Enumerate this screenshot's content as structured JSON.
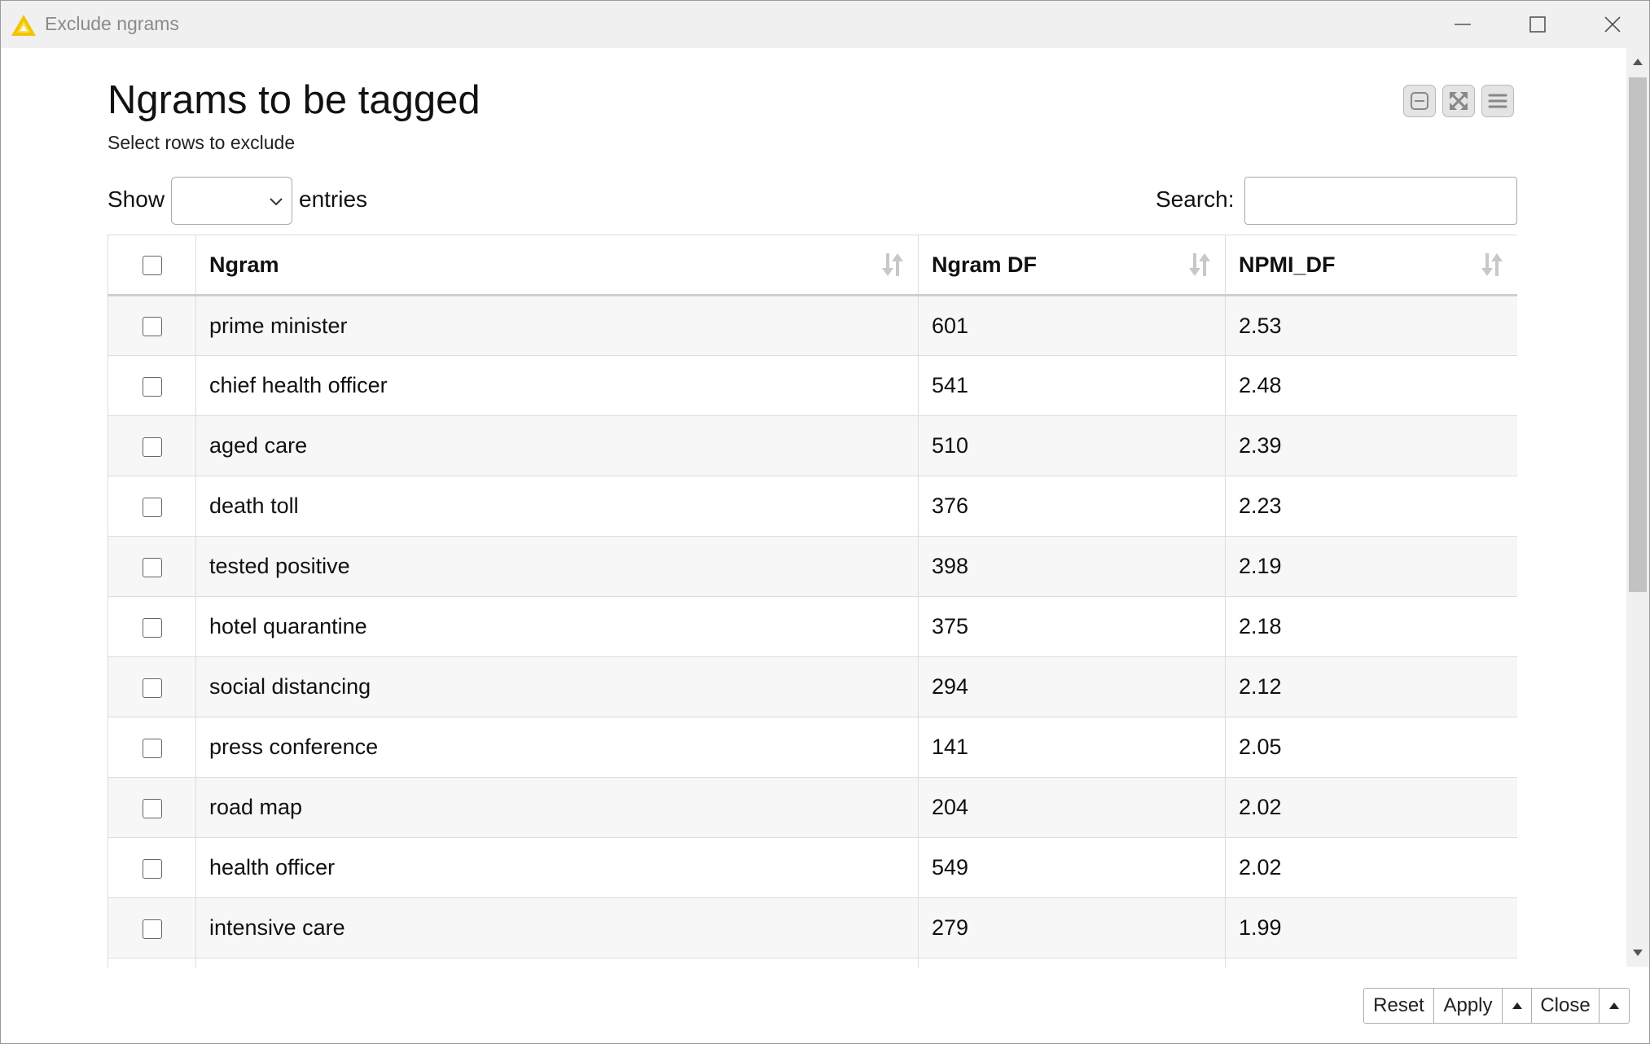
{
  "window": {
    "title": "Exclude ngrams",
    "logo_color": "#f2c500"
  },
  "header": {
    "title": "Ngrams to be tagged",
    "subtitle": "Select rows to exclude"
  },
  "toolbar": {
    "icons": [
      "minimize-panel-icon",
      "fullscreen-icon",
      "menu-icon"
    ]
  },
  "controls": {
    "show_label": "Show",
    "entries_label": "entries",
    "entries_value": "",
    "search_label": "Search:",
    "search_value": ""
  },
  "table": {
    "columns": [
      "Ngram",
      "Ngram DF",
      "NPMI_DF"
    ],
    "rows": [
      [
        "prime minister",
        "601",
        "2.53"
      ],
      [
        "chief health officer",
        "541",
        "2.48"
      ],
      [
        "aged care",
        "510",
        "2.39"
      ],
      [
        "death toll",
        "376",
        "2.23"
      ],
      [
        "tested positive",
        "398",
        "2.19"
      ],
      [
        "hotel quarantine",
        "375",
        "2.18"
      ],
      [
        "social distancing",
        "294",
        "2.12"
      ],
      [
        "press conference",
        "141",
        "2.05"
      ],
      [
        "road map",
        "204",
        "2.02"
      ],
      [
        "health officer",
        "549",
        "2.02"
      ],
      [
        "intensive care",
        "279",
        "1.99"
      ]
    ]
  },
  "footer": {
    "reset_label": "Reset",
    "apply_label": "Apply",
    "close_label": "Close"
  }
}
